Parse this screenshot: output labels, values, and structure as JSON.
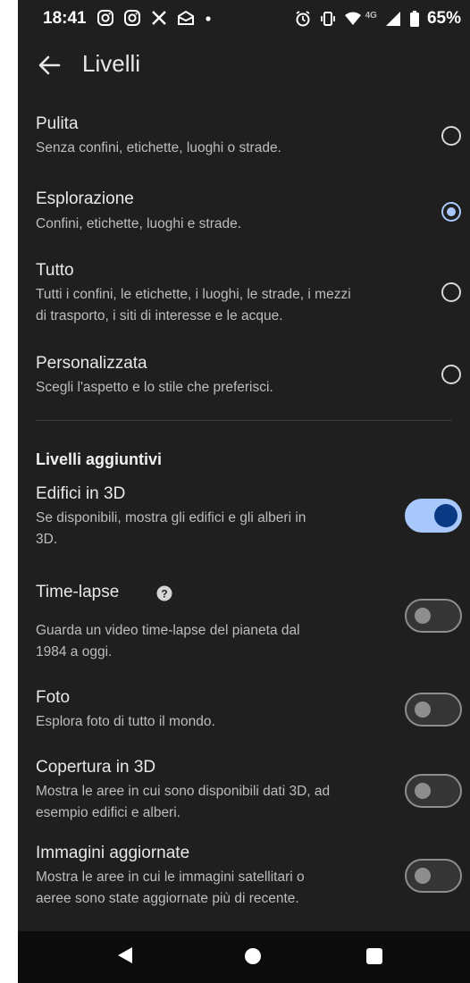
{
  "status_bar": {
    "time": "18:41",
    "network": "4G",
    "battery": "65%",
    "left_icons": [
      "instagram-icon",
      "instagram-icon",
      "x-icon",
      "mail-icon",
      "dot-icon"
    ],
    "right_icons": [
      "alarm-icon",
      "vibrate-icon",
      "wifi-icon",
      "signal-icon",
      "battery-icon"
    ]
  },
  "header": {
    "title": "Livelli"
  },
  "map_styles": [
    {
      "title": "Pulita",
      "desc": "Senza confini, etichette, luoghi o strade.",
      "selected": false
    },
    {
      "title": "Esplorazione",
      "desc": "Confini, etichette, luoghi e strade.",
      "selected": true
    },
    {
      "title": "Tutto",
      "desc_lines": [
        "Tutti i confini, le etichette, i luoghi, le strade, i mezzi",
        "di trasporto, i siti di interesse e le acque."
      ],
      "selected": false
    },
    {
      "title": "Personalizzata",
      "desc": "Scegli l'aspetto e lo stile che preferisci.",
      "selected": false
    }
  ],
  "additional_layers": {
    "section_title": "Livelli aggiuntivi",
    "items": [
      {
        "title": "Edifici in 3D",
        "desc_lines": [
          "Se disponibili, mostra gli edifici e gli alberi in",
          "3D."
        ],
        "enabled": true
      },
      {
        "title": "Time-lapse",
        "has_help": true,
        "desc_lines": [
          "Guarda un video time-lapse del pianeta dal",
          "1984 a oggi."
        ],
        "enabled": false
      },
      {
        "title": "Foto",
        "desc": "Esplora foto di tutto il mondo.",
        "enabled": false
      },
      {
        "title": "Copertura in 3D",
        "desc_lines": [
          "Mostra le aree in cui sono disponibili dati 3D, ad",
          "esempio edifici e alberi."
        ],
        "enabled": false
      },
      {
        "title": "Immagini aggiornate",
        "desc_lines": [
          "Mostra le aree in cui le immagini satellitari o",
          "aeree sono state aggiornate più di recente."
        ],
        "enabled": false
      }
    ]
  },
  "colors": {
    "background": "#1f1f1f",
    "accent": "#a8c7fa",
    "toggle_knob_on": "#0b3a84"
  }
}
